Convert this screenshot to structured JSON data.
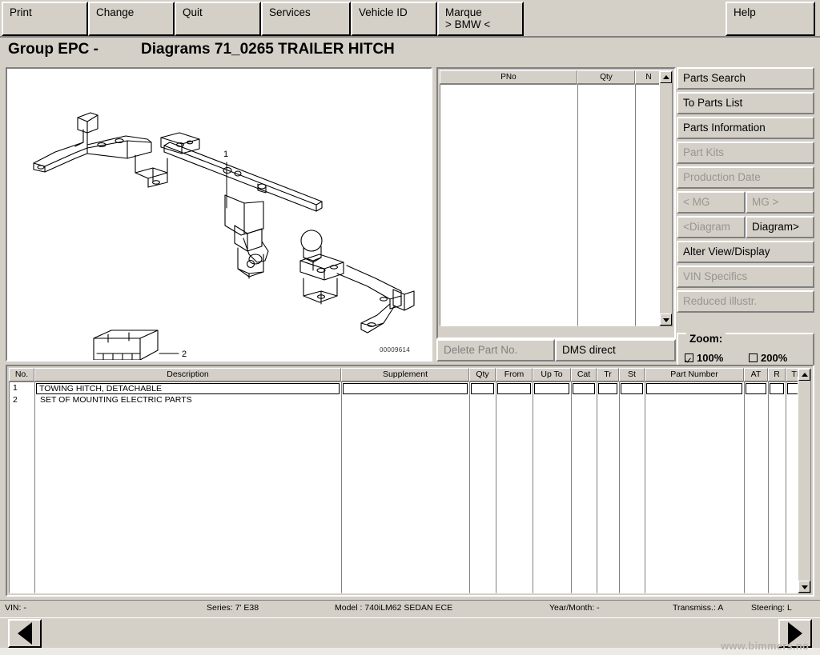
{
  "menu": {
    "items": [
      {
        "label": "Print",
        "name": "menu-print"
      },
      {
        "label": "Change",
        "name": "menu-change"
      },
      {
        "label": "Quit",
        "name": "menu-quit"
      },
      {
        "label": "Services",
        "name": "menu-services"
      },
      {
        "label": "Vehicle ID",
        "name": "menu-vehicle-id"
      },
      {
        "label": "Marque\n> BMW <",
        "name": "menu-marque"
      }
    ],
    "marque_line1": "Marque",
    "marque_line2": "> BMW <",
    "help_label": "Help"
  },
  "title": {
    "left": "Group EPC -",
    "right": "Diagrams 71_0265 TRAILER HITCH"
  },
  "diagram": {
    "id_label": "00009614",
    "callouts": [
      "1",
      "2"
    ]
  },
  "parts_grid": {
    "columns": [
      "PNo",
      "Qty",
      "N"
    ],
    "rows": []
  },
  "dms_row": {
    "delete_label": "Delete Part No.",
    "dms_label": "DMS direct"
  },
  "right_buttons": [
    {
      "label": "Parts Search",
      "enabled": true,
      "name": "parts-search-button"
    },
    {
      "label": "To Parts List",
      "enabled": true,
      "name": "to-parts-list-button"
    },
    {
      "label": "Parts Information",
      "enabled": true,
      "name": "parts-information-button"
    },
    {
      "label": "Part Kits",
      "enabled": false,
      "name": "part-kits-button"
    },
    {
      "label": "Production Date",
      "enabled": false,
      "name": "production-date-button"
    },
    {
      "label": "< MG",
      "enabled": false,
      "name": "prev-mg-button"
    },
    {
      "label": "MG >",
      "enabled": false,
      "name": "next-mg-button"
    },
    {
      "label": "<Diagram",
      "enabled": false,
      "name": "prev-diagram-button"
    },
    {
      "label": "Diagram>",
      "enabled": true,
      "name": "next-diagram-button"
    },
    {
      "label": "Alter View/Display",
      "enabled": true,
      "name": "alter-view-display-button"
    },
    {
      "label": "VIN Specifics",
      "enabled": false,
      "name": "vin-specifics-button"
    },
    {
      "label": "Reduced illustr.",
      "enabled": false,
      "name": "reduced-illustration-button"
    }
  ],
  "zoom": {
    "group_label": "Zoom:",
    "option_100": "100%",
    "option_200": "200%",
    "checked_100": true,
    "checked_200": false
  },
  "parts_table": {
    "columns": [
      "No.",
      "Description",
      "Supplement",
      "Qty",
      "From",
      "Up To",
      "Cat",
      "Tr",
      "St",
      "Part Number",
      "AT",
      "R",
      "TI"
    ],
    "rows": [
      {
        "no": "1",
        "description": "TOWING HITCH, DETACHABLE",
        "supplement": "",
        "qty": "",
        "from": "",
        "up_to": "",
        "cat": "",
        "tr": "",
        "st": "",
        "part_number": "",
        "at": "",
        "r": "",
        "ti": "",
        "selected": true
      },
      {
        "no": "2",
        "description": "SET OF MOUNTING ELECTRIC PARTS",
        "supplement": "",
        "qty": "",
        "from": "",
        "up_to": "",
        "cat": "",
        "tr": "",
        "st": "",
        "part_number": "",
        "at": "",
        "r": "",
        "ti": "",
        "selected": false
      }
    ]
  },
  "status": {
    "vin": "VIN: -",
    "series": "Series: 7' E38",
    "model": "Model : 740iLM62 SEDAN ECE",
    "year_month": "Year/Month: -",
    "transmission": "Transmiss.: A",
    "steering": "Steering: L"
  },
  "nav": {
    "prev_name": "prev-page-button",
    "next_name": "next-page-button"
  },
  "watermark": "www.bimmers.no",
  "colors": {
    "face": "#d4d0c8",
    "shadow": "#808080",
    "disabled_text": "#999490",
    "white": "#ffffff"
  }
}
